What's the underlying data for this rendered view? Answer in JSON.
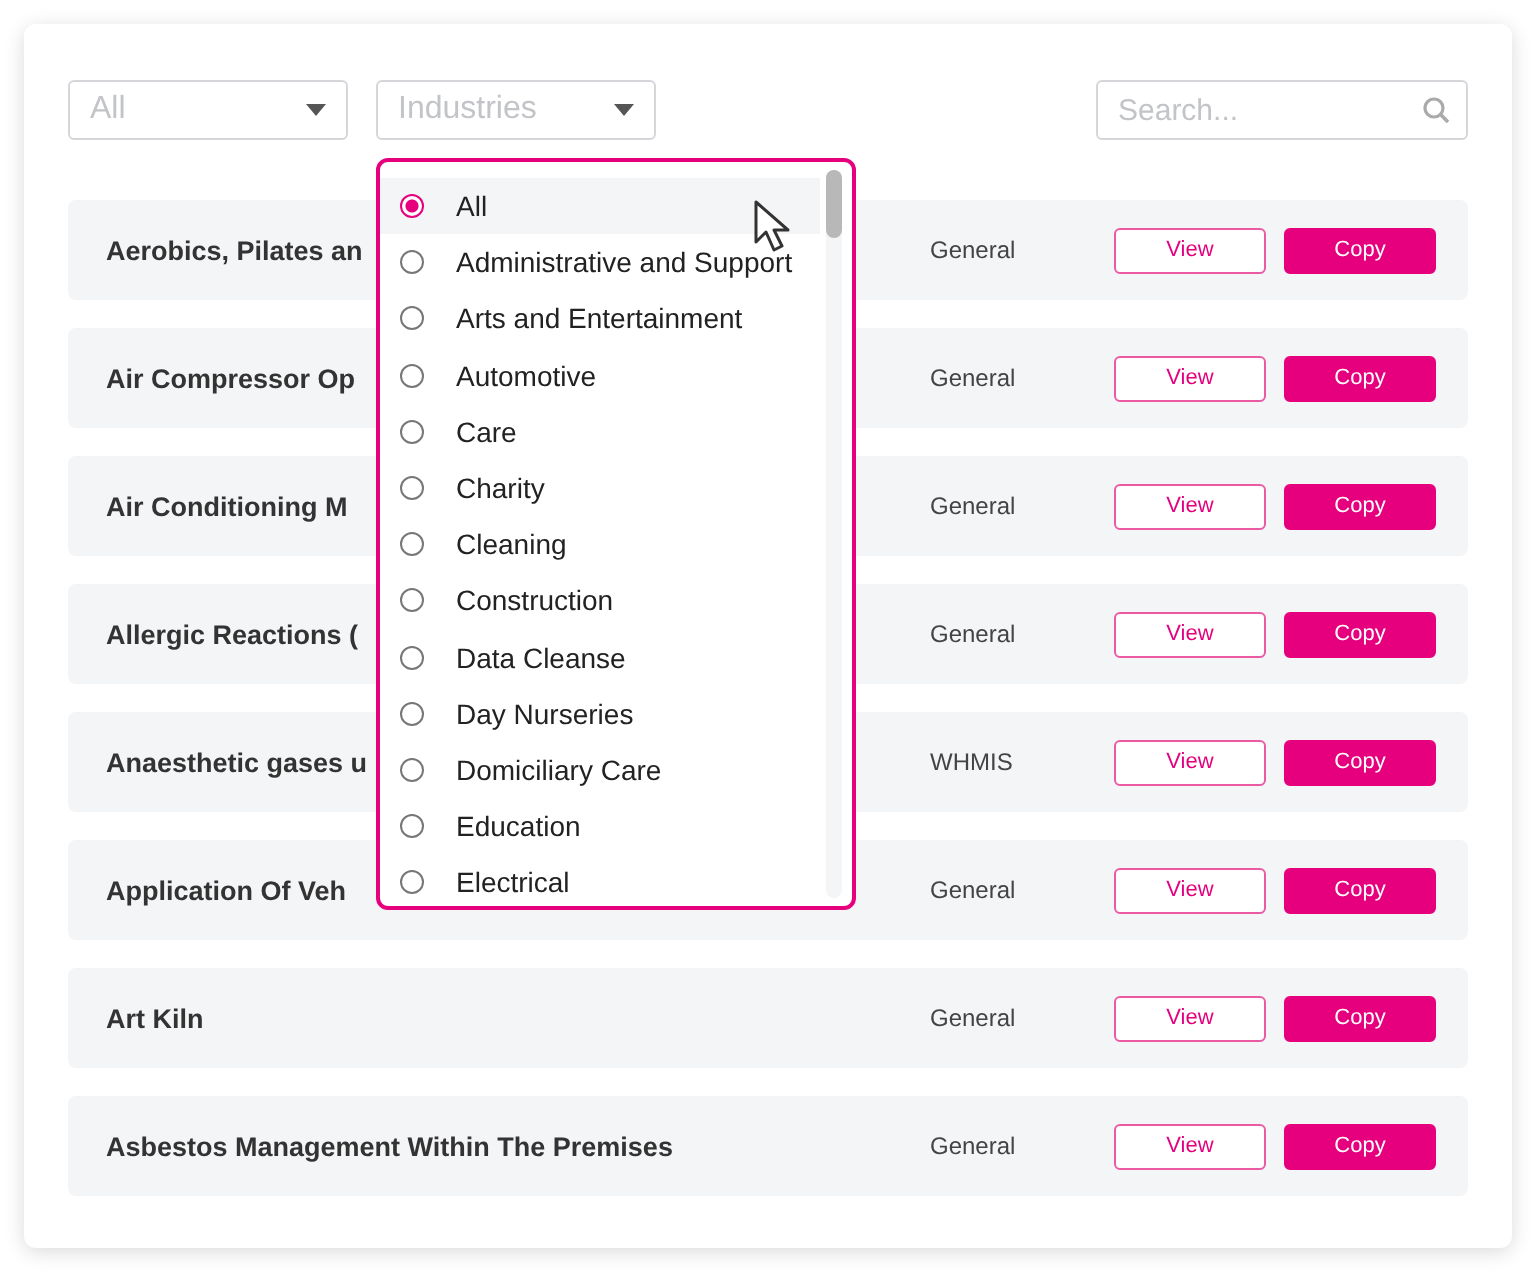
{
  "filters": {
    "category": {
      "value": "All"
    },
    "industries": {
      "placeholder": "Industries",
      "open": true,
      "options": [
        {
          "label": "All",
          "selected": true
        },
        {
          "label": "Administrative and Support",
          "selected": false
        },
        {
          "label": "Arts and Entertainment",
          "selected": false
        },
        {
          "label": "Automotive",
          "selected": false
        },
        {
          "label": "Care",
          "selected": false
        },
        {
          "label": "Charity",
          "selected": false
        },
        {
          "label": "Cleaning",
          "selected": false
        },
        {
          "label": "Construction",
          "selected": false
        },
        {
          "label": "Data Cleanse",
          "selected": false
        },
        {
          "label": "Day Nurseries",
          "selected": false
        },
        {
          "label": "Domiciliary Care",
          "selected": false
        },
        {
          "label": "Education",
          "selected": false
        },
        {
          "label": "Electrical",
          "selected": false
        }
      ]
    }
  },
  "search": {
    "placeholder": "Search..."
  },
  "rows": [
    {
      "title": "Aerobics, Pilates an",
      "category": "General",
      "view": "View",
      "copy": "Copy"
    },
    {
      "title": "Air Compressor Op",
      "category": "General",
      "view": "View",
      "copy": "Copy"
    },
    {
      "title": "Air Conditioning M",
      "category": "General",
      "view": "View",
      "copy": "Copy"
    },
    {
      "title": "Allergic Reactions (",
      "category": "General",
      "view": "View",
      "copy": "Copy"
    },
    {
      "title": "Anaesthetic gases u",
      "category": "WHMIS",
      "view": "View",
      "copy": "Copy"
    },
    {
      "title": "Application Of Veh",
      "category": "General",
      "view": "View",
      "copy": "Copy"
    },
    {
      "title": "Art Kiln",
      "category": "General",
      "view": "View",
      "copy": "Copy"
    },
    {
      "title": "Asbestos Management Within The Premises",
      "category": "General",
      "view": "View",
      "copy": "Copy"
    }
  ]
}
